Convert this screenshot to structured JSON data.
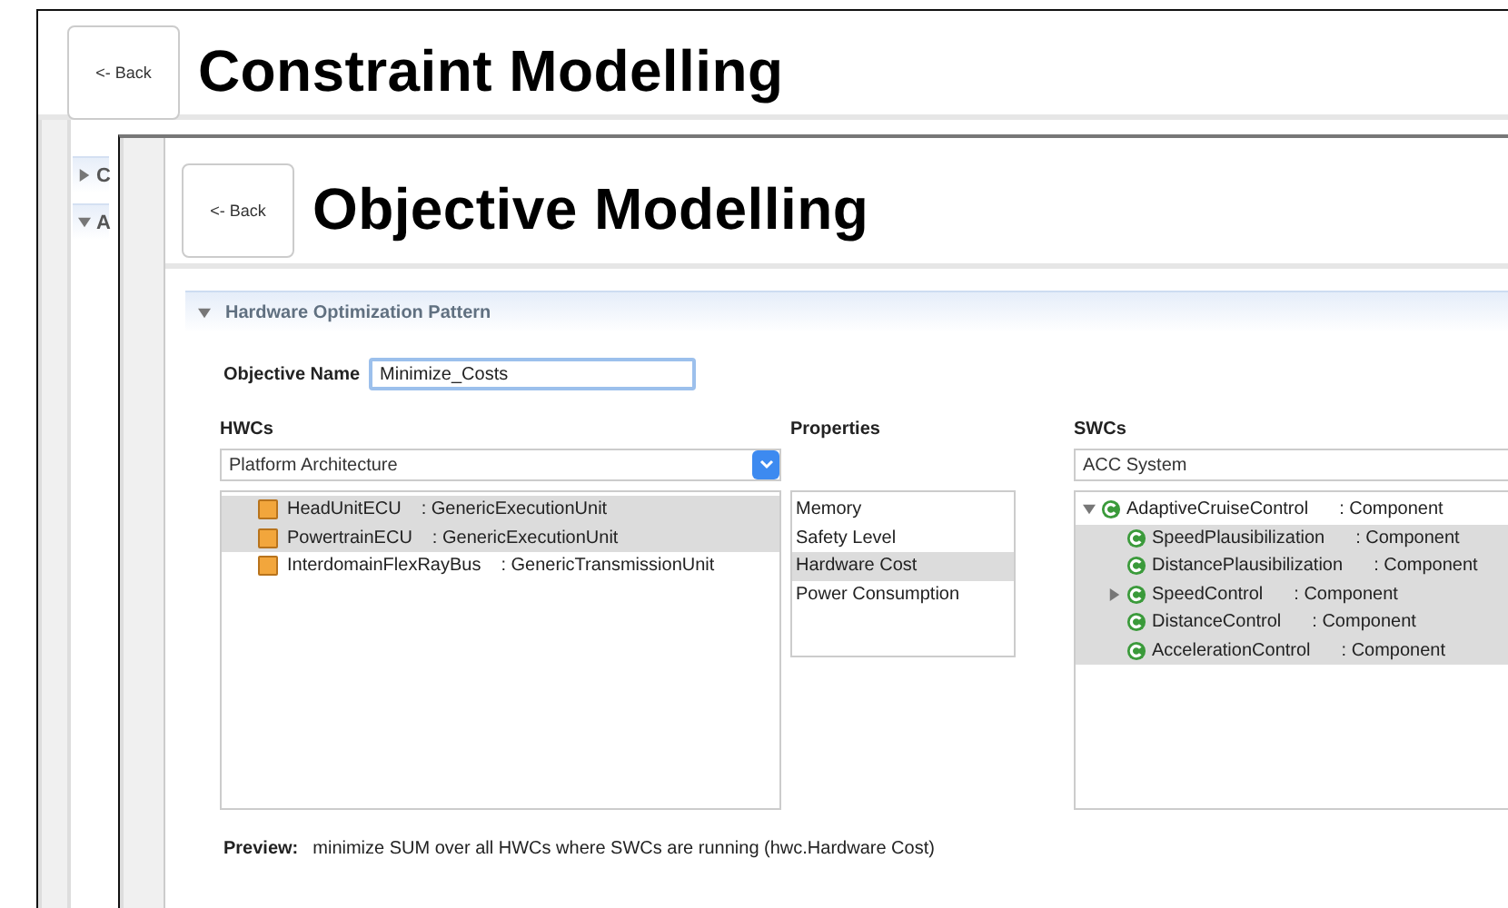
{
  "back_window": {
    "back_button": "<- Back",
    "title": "Constraint Modelling",
    "sidebar_sections": [
      {
        "label": "C",
        "expanded": false
      },
      {
        "label": "A",
        "expanded": true
      }
    ]
  },
  "front_window": {
    "back_button": "<- Back",
    "title": "Objective Modelling",
    "section": {
      "title": "Hardware Optimization Pattern",
      "expanded": true,
      "objective_name": {
        "label": "Objective Name",
        "value": "Minimize_Costs"
      },
      "hwcs": {
        "label": "HWCs",
        "dropdown": "Platform Architecture",
        "items": [
          {
            "name": "HeadUnitECU",
            "type": ": GenericExecutionUnit",
            "selected": true
          },
          {
            "name": "PowertrainECU",
            "type": ": GenericExecutionUnit",
            "selected": true
          },
          {
            "name": "InterdomainFlexRayBus",
            "type": ": GenericTransmissionUnit",
            "selected": false
          }
        ]
      },
      "properties": {
        "label": "Properties",
        "items": [
          {
            "label": "Memory",
            "selected": false
          },
          {
            "label": "Safety Level",
            "selected": false
          },
          {
            "label": "Hardware Cost",
            "selected": true
          },
          {
            "label": "Power Consumption",
            "selected": false
          }
        ]
      },
      "swcs": {
        "label": "SWCs",
        "dropdown": "ACC System",
        "tree": [
          {
            "name": "AdaptiveCruiseControl",
            "type": ": Component",
            "selected": false,
            "expanded": true,
            "children": [
              {
                "name": "SpeedPlausibilization",
                "type": ": Component",
                "selected": true
              },
              {
                "name": "DistancePlausibilization",
                "type": ": Component",
                "selected": true
              },
              {
                "name": "SpeedControl",
                "type": ": Component",
                "selected": true,
                "expanded": false
              },
              {
                "name": "DistanceControl",
                "type": ": Component",
                "selected": true
              },
              {
                "name": "AccelerationControl",
                "type": ": Component",
                "selected": true
              }
            ]
          }
        ]
      },
      "preview": {
        "label": "Preview:",
        "text": "minimize SUM over all HWCs where SWCs are running (hwc.Hardware Cost)"
      }
    }
  }
}
